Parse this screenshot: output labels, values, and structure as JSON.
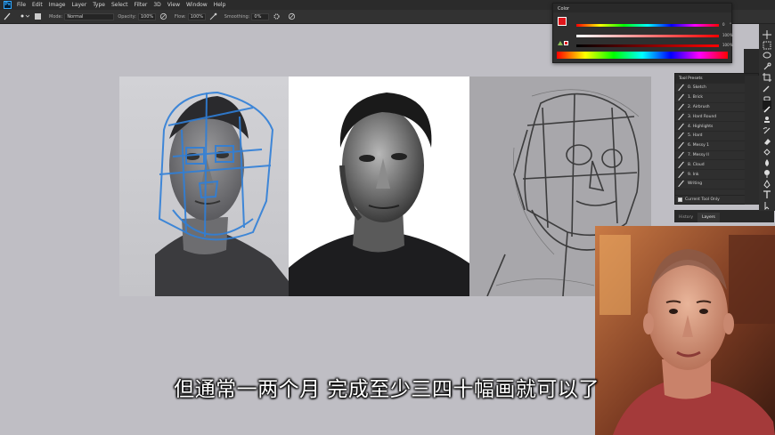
{
  "menubar": {
    "logo": "Ps",
    "items": [
      "File",
      "Edit",
      "Image",
      "Layer",
      "Type",
      "Select",
      "Filter",
      "3D",
      "View",
      "Window",
      "Help"
    ]
  },
  "options": {
    "mode_label": "Mode:",
    "mode_value": "Normal",
    "opacity_label": "Opacity:",
    "opacity_value": "100%",
    "flow_label": "Flow:",
    "flow_value": "100%",
    "smoothing_label": "Smoothing:",
    "smoothing_value": "0%"
  },
  "color_panel": {
    "title": "Color",
    "values": [
      "0",
      "100",
      "100"
    ],
    "units": [
      "°",
      "%",
      "%"
    ]
  },
  "tool_presets": {
    "title": "Tool Presets",
    "items": [
      "0. Sketch",
      "1. Brick",
      "2. Airbrush",
      "3. Hard Round",
      "4. Highlights",
      "5. Hard",
      "6. Messy 1",
      "7. Messy II",
      "8. Cloud",
      "9. Ink",
      "Writing"
    ],
    "current_tool_only": "Current Tool Only"
  },
  "layers_tabs": [
    "History",
    "Layers"
  ],
  "subtitle": "但通常一两个月 完成至少三四十幅画就可以了",
  "colors": {
    "foreground": "#e0161b",
    "background": "#ffffff",
    "ps_blue": "#31a8ff",
    "sketch_blue": "#2f7fd8"
  }
}
